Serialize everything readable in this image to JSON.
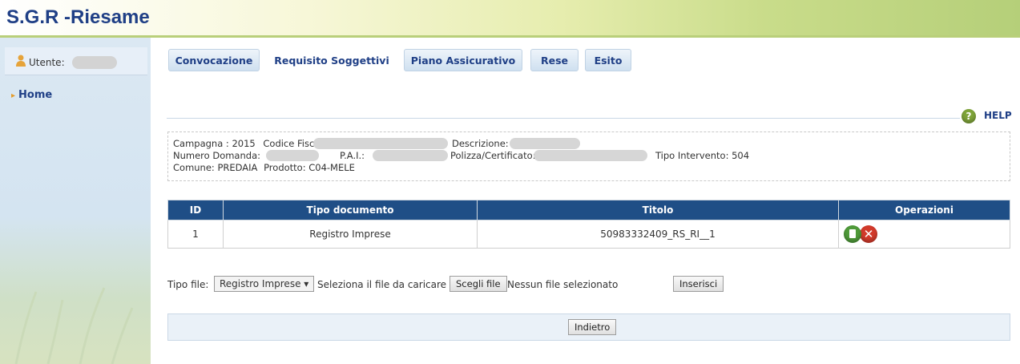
{
  "app": {
    "title": "S.G.R -Riesame"
  },
  "sidebar": {
    "user_label": "Utente:",
    "items": [
      {
        "label": "Home"
      }
    ]
  },
  "tabs": [
    {
      "label": "Convocazione",
      "active": false
    },
    {
      "label": "Requisito Soggettivi",
      "active": true
    },
    {
      "label": "Piano Assicurativo",
      "active": false
    },
    {
      "label": "Rese",
      "active": false
    },
    {
      "label": "Esito",
      "active": false
    }
  ],
  "help": {
    "label": "HELP",
    "icon": "question-icon"
  },
  "info": {
    "campagna_label": "Campagna : 2015",
    "codice_fiscale_label": "Codice Fiscale:",
    "descrizione_label": "Descrizione:",
    "numero_domanda_label": "Numero Domanda:",
    "pai_label": "P.A.I.:",
    "polizza_label": "Polizza/Certificato:",
    "tipo_intervento_label": "Tipo Intervento: 504",
    "comune_label": "Comune: PREDAIA",
    "prodotto_label": "Prodotto: C04-MELE"
  },
  "table": {
    "headers": [
      "ID",
      "Tipo documento",
      "Titolo",
      "Operazioni"
    ],
    "rows": [
      {
        "id": "1",
        "tipo": "Registro Imprese",
        "titolo": "50983332409_RS_RI__1"
      }
    ]
  },
  "upload": {
    "tipo_file_label": "Tipo file:",
    "tipo_file_value": "Registro Imprese ▾",
    "seleziona_label": "Seleziona il file da caricare",
    "choose_button": "Scegli file",
    "no_file_text": "Nessun file selezionato",
    "insert_button": "Inserisci"
  },
  "footer": {
    "back_button": "Indietro"
  },
  "colors": {
    "accent": "#1f4e86",
    "title": "#1f3f86"
  }
}
